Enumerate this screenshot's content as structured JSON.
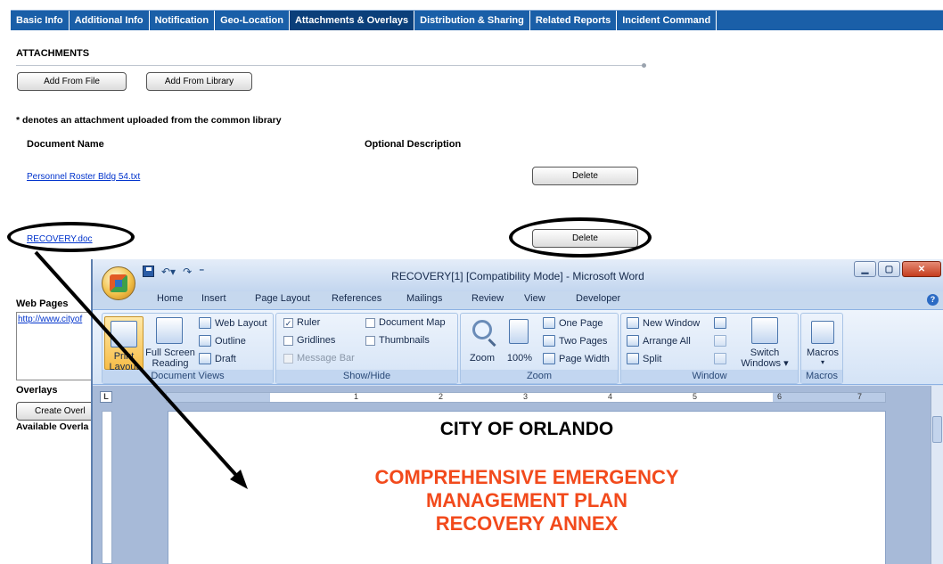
{
  "tabs": [
    "Basic Info",
    "Additional Info",
    "Notification",
    "Geo-Location",
    "Attachments & Overlays",
    "Distribution & Sharing",
    "Related Reports",
    "Incident Command"
  ],
  "attachments": {
    "title": "ATTACHMENTS",
    "add_from_file": "Add From File",
    "add_from_library": "Add From Library",
    "note": "* denotes an attachment uploaded from the common library",
    "col_document": "Document Name",
    "col_description": "Optional Description",
    "rows": [
      {
        "name": "Personnel Roster Bldg 54.txt",
        "delete": "Delete"
      },
      {
        "name": "RECOVERY.doc",
        "delete": "Delete"
      }
    ]
  },
  "web_pages": {
    "label": "Web Pages",
    "items": [
      "http://www.cityof"
    ]
  },
  "overlays": {
    "label": "Overlays",
    "create": "Create Overl",
    "available": "Available Overla"
  },
  "word": {
    "title": "RECOVERY[1] [Compatibility Mode] - Microsoft Word",
    "ribbon_tabs": [
      "Home",
      "Insert",
      "Page Layout",
      "References",
      "Mailings",
      "Review",
      "View",
      "Developer"
    ],
    "active_tab": "View",
    "groups": {
      "document_views": {
        "label": "Document Views",
        "print_layout": [
          "Print",
          "Layout"
        ],
        "full_screen": [
          "Full Screen",
          "Reading"
        ],
        "web_layout": "Web Layout",
        "outline": "Outline",
        "draft": "Draft"
      },
      "show_hide": {
        "label": "Show/Hide",
        "ruler": "Ruler",
        "gridlines": "Gridlines",
        "message_bar": "Message Bar",
        "document_map": "Document Map",
        "thumbnails": "Thumbnails"
      },
      "zoom": {
        "label": "Zoom",
        "zoom": "Zoom",
        "pct": "100%",
        "one_page": "One Page",
        "two_pages": "Two Pages",
        "page_width": "Page Width"
      },
      "window": {
        "label": "Window",
        "new_window": "New Window",
        "arrange_all": "Arrange All",
        "split": "Split",
        "switch_windows": [
          "Switch",
          "Windows ▾"
        ]
      },
      "macros": {
        "label": "Macros",
        "macros": "Macros"
      }
    },
    "ruler_numbers": [
      "1",
      "2",
      "3",
      "4",
      "5",
      "6",
      "7"
    ],
    "document": {
      "heading": "CITY OF ORLANDO",
      "subtitle_lines": [
        "COMPREHENSIVE EMERGENCY",
        "MANAGEMENT PLAN",
        "RECOVERY ANNEX"
      ]
    }
  },
  "colors": {
    "tab_bar": "#1a5fa8",
    "tab_active": "#0b3f7a",
    "link": "#0033cc",
    "doc_red": "#f24a1c"
  }
}
